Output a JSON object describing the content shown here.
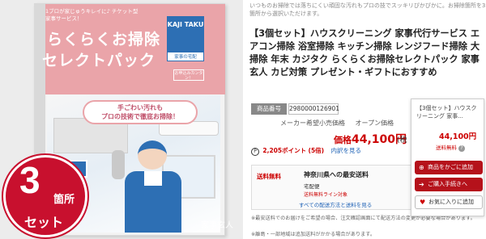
{
  "cover": {
    "tagline": "1ブロが家じゅうキレイに♪ チケット型家事サービス！",
    "title_line1": "らくらくお掃除",
    "title_line2": "セレクトパック",
    "logo": "KAJI TAKU",
    "logo_sub": "家事の宅配",
    "mini_badge": "お申込みカンタン！",
    "bubble_line1": "手ごわい汚れも",
    "bubble_line2": "プロの技術で徹底お掃除！",
    "brand": "家事玄人"
  },
  "sticker": {
    "number": "3",
    "kasho": "箇所",
    "set": "セット"
  },
  "intro_text": "いつものお掃除では落ちにくい頑固な汚れもプロの技でスッキリぴかぴかに。お掃除箇所を3箇所から選択いただけます。",
  "product_title": "【3個セット】ハウスクリーニング 家事代行サービス エアコン掃除 浴室掃除 キッチン掃除 レンジフード掃除 大掃除 年末 カジタク らくらくお掃除セレクトパック 家事玄人 カビ対策 プレゼント・ギフトにおすすめ",
  "sku": {
    "label": "商品番号",
    "value": "2980000126901"
  },
  "msrp": {
    "label": "メーカー希望小売価格",
    "value": "オープン価格"
  },
  "price": {
    "label": "価格",
    "value": "44,100円",
    "tax": "(税"
  },
  "points": {
    "icon": "P",
    "value": "2,205ポイント",
    "multiplier": "(5倍)",
    "link": "内訳を見る"
  },
  "shipping": {
    "free": "送料無料",
    "destination": "神奈川県への最安送料",
    "payment": "宅配便",
    "free_line": "送料無料ライン対象",
    "more_link": "すべての配送方法と送料を見る"
  },
  "footnotes": {
    "line1": "※最安送料でのお届けをご希望の場合、注文確認画面にて配送方法の変更が必要な場合があります。",
    "line2": "※離島・一部地域は追加送料がかかる場合があります。"
  },
  "cart_panel": {
    "title": "【3個セット】ハウスクリーニング 家事...",
    "price": "44,100円",
    "shipping": "送料無料",
    "shipping_help": "?",
    "add_to_cart": "商品をかごに追加",
    "buy_now": "ご購入手続きへ",
    "favorite": "お気に入りに追加"
  },
  "colors": {
    "accent_red": "#cc0000",
    "button_red": "#b5121b",
    "cover_pink": "#eaa4a9",
    "link_blue": "#1a5fb4"
  }
}
